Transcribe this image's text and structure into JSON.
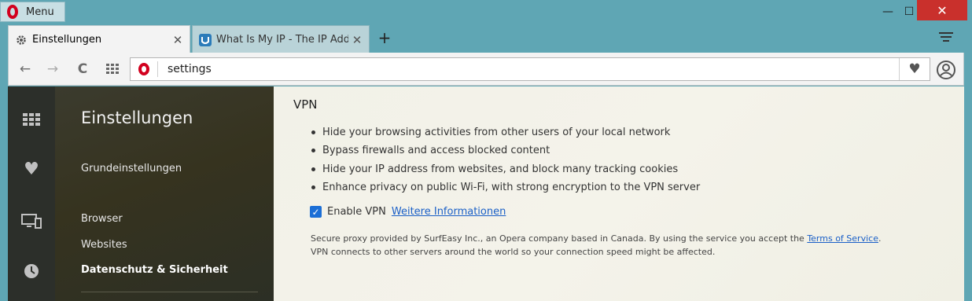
{
  "titlebar": {
    "menu_label": "Menu",
    "minimize": "—",
    "maximize": "☐",
    "close": "✕"
  },
  "tabs": [
    {
      "title": "Einstellungen",
      "icon": "gear-icon",
      "close": "✕"
    },
    {
      "title": "What Is My IP - The IP Address",
      "icon": "ip-site-favicon",
      "close": "✕"
    }
  ],
  "newtab_label": "+",
  "toolbar": {
    "back": "←",
    "forward": "→",
    "reload": "C",
    "url": "settings",
    "heart": "♥"
  },
  "sidebar": {
    "title": "Einstellungen",
    "items": [
      {
        "label": "Grundeinstellungen",
        "active": false
      },
      {
        "label": "Browser",
        "active": false
      },
      {
        "label": "Websites",
        "active": false
      },
      {
        "label": "Datenschutz & Sicherheit",
        "active": true
      }
    ]
  },
  "vpn": {
    "heading": "VPN",
    "bullets": [
      "Hide your browsing activities from other users of your local network",
      "Bypass firewalls and access blocked content",
      "Hide your IP address from websites, and block many tracking cookies",
      "Enhance privacy on public Wi-Fi, with strong encryption to the VPN server"
    ],
    "enable_label": "Enable VPN",
    "enable_checked": true,
    "more_info_link": "Weitere Informationen",
    "note_line1_prefix": "Secure proxy provided by SurfEasy Inc., an Opera company based in Canada. By using the service you accept the ",
    "terms_link": "Terms of Service",
    "note_line1_suffix": ".",
    "note_line2": "VPN connects to other servers around the world so your connection speed might be affected."
  },
  "colors": {
    "accent": "#d2001e",
    "link": "#1a5fc7",
    "checkbox": "#1c6fd6",
    "frame": "#5fa6b4"
  }
}
